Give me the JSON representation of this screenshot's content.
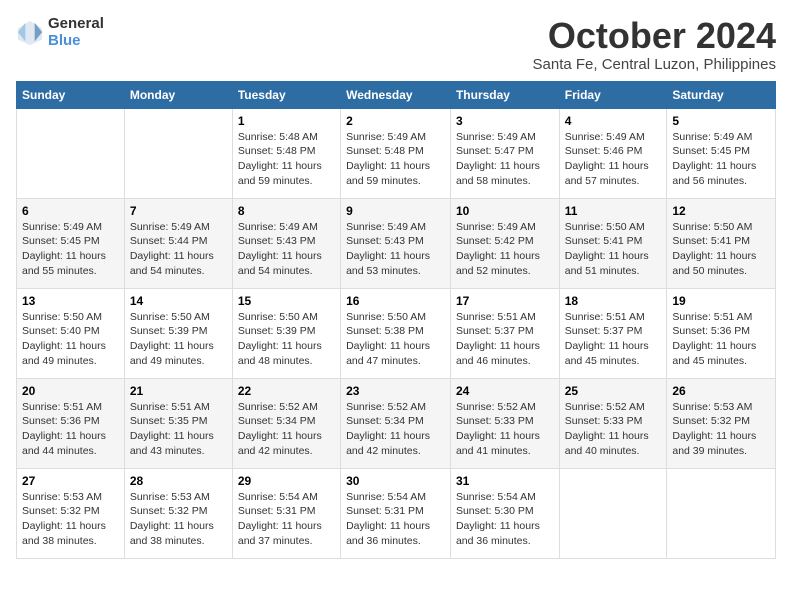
{
  "logo": {
    "general": "General",
    "blue": "Blue"
  },
  "title": {
    "month": "October 2024",
    "location": "Santa Fe, Central Luzon, Philippines"
  },
  "headers": [
    "Sunday",
    "Monday",
    "Tuesday",
    "Wednesday",
    "Thursday",
    "Friday",
    "Saturday"
  ],
  "weeks": [
    [
      {
        "day": "",
        "info": ""
      },
      {
        "day": "",
        "info": ""
      },
      {
        "day": "1",
        "info": "Sunrise: 5:48 AM\nSunset: 5:48 PM\nDaylight: 11 hours and 59 minutes."
      },
      {
        "day": "2",
        "info": "Sunrise: 5:49 AM\nSunset: 5:48 PM\nDaylight: 11 hours and 59 minutes."
      },
      {
        "day": "3",
        "info": "Sunrise: 5:49 AM\nSunset: 5:47 PM\nDaylight: 11 hours and 58 minutes."
      },
      {
        "day": "4",
        "info": "Sunrise: 5:49 AM\nSunset: 5:46 PM\nDaylight: 11 hours and 57 minutes."
      },
      {
        "day": "5",
        "info": "Sunrise: 5:49 AM\nSunset: 5:45 PM\nDaylight: 11 hours and 56 minutes."
      }
    ],
    [
      {
        "day": "6",
        "info": "Sunrise: 5:49 AM\nSunset: 5:45 PM\nDaylight: 11 hours and 55 minutes."
      },
      {
        "day": "7",
        "info": "Sunrise: 5:49 AM\nSunset: 5:44 PM\nDaylight: 11 hours and 54 minutes."
      },
      {
        "day": "8",
        "info": "Sunrise: 5:49 AM\nSunset: 5:43 PM\nDaylight: 11 hours and 54 minutes."
      },
      {
        "day": "9",
        "info": "Sunrise: 5:49 AM\nSunset: 5:43 PM\nDaylight: 11 hours and 53 minutes."
      },
      {
        "day": "10",
        "info": "Sunrise: 5:49 AM\nSunset: 5:42 PM\nDaylight: 11 hours and 52 minutes."
      },
      {
        "day": "11",
        "info": "Sunrise: 5:50 AM\nSunset: 5:41 PM\nDaylight: 11 hours and 51 minutes."
      },
      {
        "day": "12",
        "info": "Sunrise: 5:50 AM\nSunset: 5:41 PM\nDaylight: 11 hours and 50 minutes."
      }
    ],
    [
      {
        "day": "13",
        "info": "Sunrise: 5:50 AM\nSunset: 5:40 PM\nDaylight: 11 hours and 49 minutes."
      },
      {
        "day": "14",
        "info": "Sunrise: 5:50 AM\nSunset: 5:39 PM\nDaylight: 11 hours and 49 minutes."
      },
      {
        "day": "15",
        "info": "Sunrise: 5:50 AM\nSunset: 5:39 PM\nDaylight: 11 hours and 48 minutes."
      },
      {
        "day": "16",
        "info": "Sunrise: 5:50 AM\nSunset: 5:38 PM\nDaylight: 11 hours and 47 minutes."
      },
      {
        "day": "17",
        "info": "Sunrise: 5:51 AM\nSunset: 5:37 PM\nDaylight: 11 hours and 46 minutes."
      },
      {
        "day": "18",
        "info": "Sunrise: 5:51 AM\nSunset: 5:37 PM\nDaylight: 11 hours and 45 minutes."
      },
      {
        "day": "19",
        "info": "Sunrise: 5:51 AM\nSunset: 5:36 PM\nDaylight: 11 hours and 45 minutes."
      }
    ],
    [
      {
        "day": "20",
        "info": "Sunrise: 5:51 AM\nSunset: 5:36 PM\nDaylight: 11 hours and 44 minutes."
      },
      {
        "day": "21",
        "info": "Sunrise: 5:51 AM\nSunset: 5:35 PM\nDaylight: 11 hours and 43 minutes."
      },
      {
        "day": "22",
        "info": "Sunrise: 5:52 AM\nSunset: 5:34 PM\nDaylight: 11 hours and 42 minutes."
      },
      {
        "day": "23",
        "info": "Sunrise: 5:52 AM\nSunset: 5:34 PM\nDaylight: 11 hours and 42 minutes."
      },
      {
        "day": "24",
        "info": "Sunrise: 5:52 AM\nSunset: 5:33 PM\nDaylight: 11 hours and 41 minutes."
      },
      {
        "day": "25",
        "info": "Sunrise: 5:52 AM\nSunset: 5:33 PM\nDaylight: 11 hours and 40 minutes."
      },
      {
        "day": "26",
        "info": "Sunrise: 5:53 AM\nSunset: 5:32 PM\nDaylight: 11 hours and 39 minutes."
      }
    ],
    [
      {
        "day": "27",
        "info": "Sunrise: 5:53 AM\nSunset: 5:32 PM\nDaylight: 11 hours and 38 minutes."
      },
      {
        "day": "28",
        "info": "Sunrise: 5:53 AM\nSunset: 5:32 PM\nDaylight: 11 hours and 38 minutes."
      },
      {
        "day": "29",
        "info": "Sunrise: 5:54 AM\nSunset: 5:31 PM\nDaylight: 11 hours and 37 minutes."
      },
      {
        "day": "30",
        "info": "Sunrise: 5:54 AM\nSunset: 5:31 PM\nDaylight: 11 hours and 36 minutes."
      },
      {
        "day": "31",
        "info": "Sunrise: 5:54 AM\nSunset: 5:30 PM\nDaylight: 11 hours and 36 minutes."
      },
      {
        "day": "",
        "info": ""
      },
      {
        "day": "",
        "info": ""
      }
    ]
  ]
}
